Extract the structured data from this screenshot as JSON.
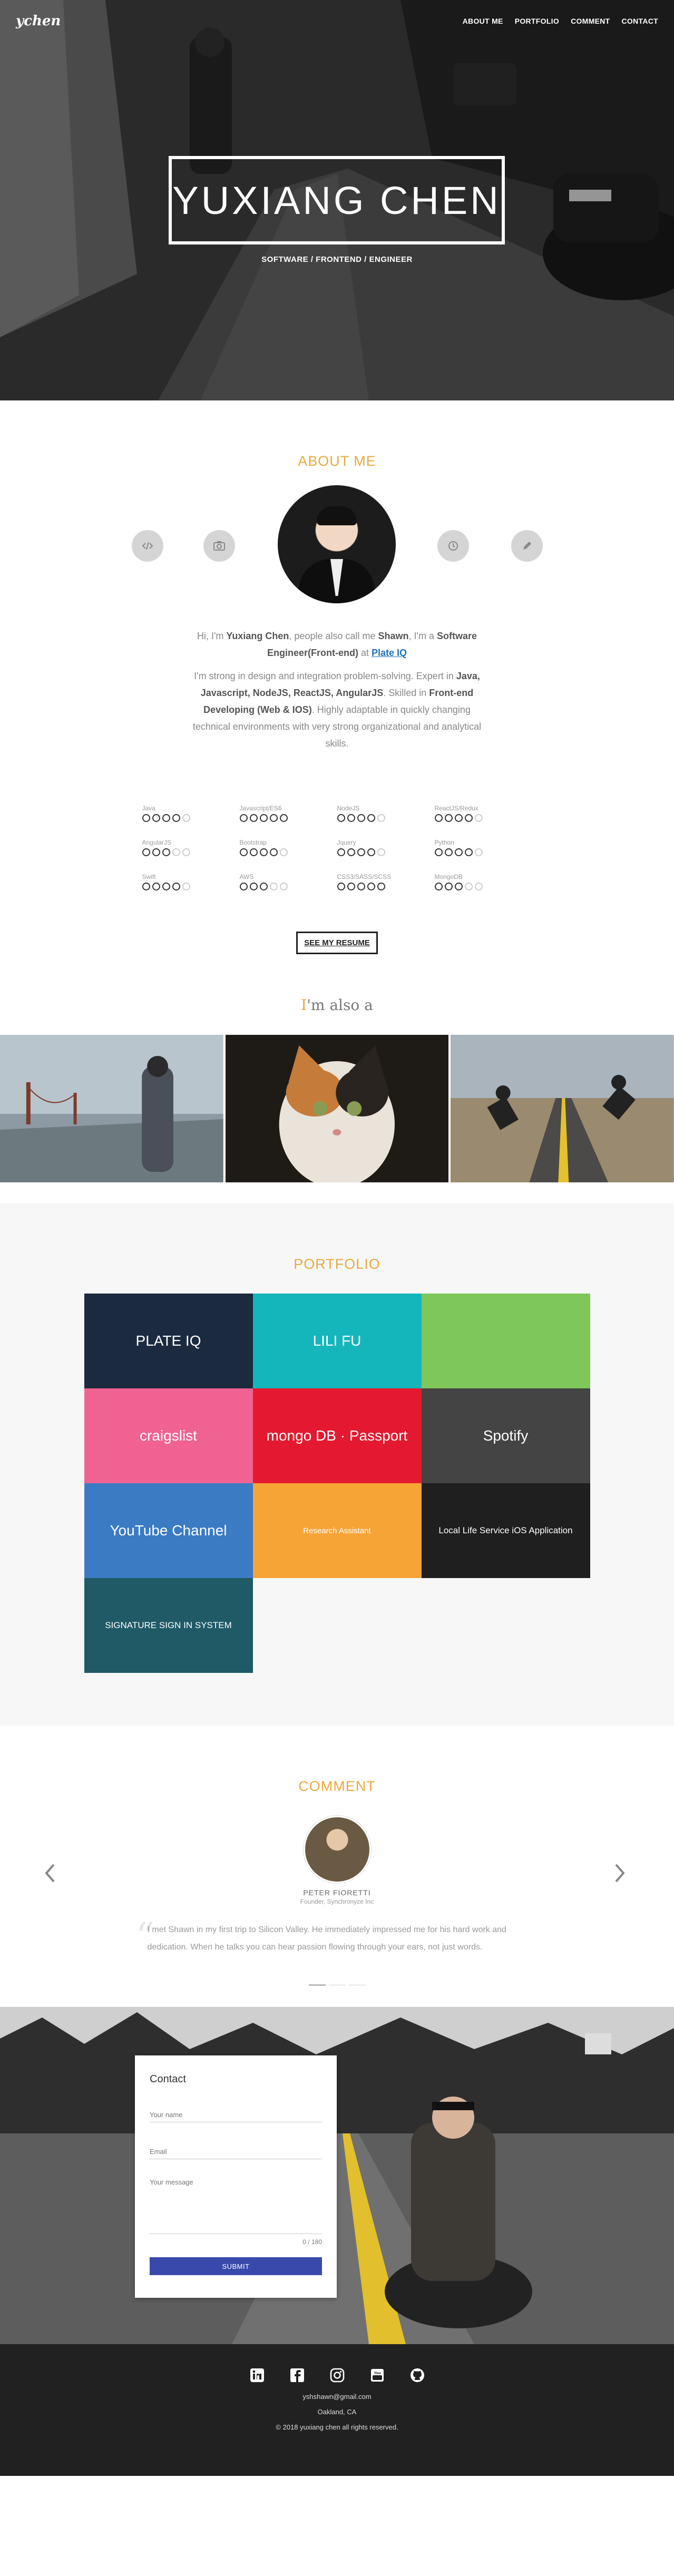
{
  "brand": {
    "logo": "ychen"
  },
  "nav": [
    {
      "label": "ABOUT ME"
    },
    {
      "label": "PORTFOLIO"
    },
    {
      "label": "COMMENT"
    },
    {
      "label": "CONTACT"
    }
  ],
  "hero": {
    "name": "YUXIANG CHEN",
    "subtitle": "SOFTWARE / FRONTEND / ENGINEER"
  },
  "about": {
    "title": "ABOUT ME",
    "icons": [
      "code-icon",
      "camera-icon",
      "clock-icon",
      "pencil-icon"
    ],
    "p1_a": "Hi, I'm ",
    "p1_name": "Yuxiang Chen",
    "p1_b": ", people also call me ",
    "p1_nick": "Shawn",
    "p1_c": ", I'm a ",
    "p1_role": "Software Engineer(Front-end)",
    "p1_d": " at ",
    "p1_company": "Plate IQ",
    "p2_a": "I'm strong in design and integration problem-solving. Expert in ",
    "p2_tech": "Java, Javascript, NodeJS, ReactJS, AngularJS",
    "p2_b": ". Skilled in ",
    "p2_dev": "Front-end Developing (Web & IOS)",
    "p2_c": ". Highly adaptable in quickly changing technical environments with very strong organizational and analytical skills.",
    "resume_label": "SEE MY RESUME",
    "also_i": "I",
    "also_rest": "'m also a"
  },
  "skills": [
    {
      "name": "Java",
      "level": 4
    },
    {
      "name": "Javascript/ES6",
      "level": 5
    },
    {
      "name": "NodeJS",
      "level": 4
    },
    {
      "name": "ReactJS/Redux",
      "level": 4
    },
    {
      "name": "AngularJS",
      "level": 3
    },
    {
      "name": "Bootstrap",
      "level": 4
    },
    {
      "name": "Jquery",
      "level": 4
    },
    {
      "name": "Python",
      "level": 4
    },
    {
      "name": "Swift",
      "level": 4
    },
    {
      "name": "AWS",
      "level": 3
    },
    {
      "name": "CSS3/SASS/SCSS",
      "level": 5
    },
    {
      "name": "MongoDB",
      "level": 3
    }
  ],
  "portfolio": {
    "title": "PORTFOLIO",
    "tiles": [
      {
        "label": "PLATE IQ",
        "bg": "#1b2a3f"
      },
      {
        "label": "LILI FU",
        "bg": "#14b6bb"
      },
      {
        "label": "",
        "bg": "#7dc75b"
      },
      {
        "label": "craigslist",
        "bg": "#f06292"
      },
      {
        "label": "mongo DB · Passport",
        "bg": "#e4192f"
      },
      {
        "label": "Spotify",
        "bg": "#444444"
      },
      {
        "label": "YouTube Channel",
        "bg": "#3a7bc4"
      },
      {
        "label": "Research Assistant",
        "bg": "#f7a437"
      },
      {
        "label": "Local Life Service iOS Application",
        "bg": "#1f1f1f"
      },
      {
        "label": "SIGNATURE SIGN IN SYSTEM",
        "bg": "#1f5a66"
      }
    ]
  },
  "comment": {
    "title": "COMMENT",
    "name": "PETER FIORETTI",
    "role": "Founder, Synchronyze Inc",
    "quote": "I met Shawn in my first trip to Silicon Valley. He immediately impressed me for his hard work and dedication. When he talks you can hear passion flowing through your ears, not just words."
  },
  "contact": {
    "title": "Contact",
    "name_placeholder": "Your name",
    "email_placeholder": "Email",
    "message_placeholder": "Your message",
    "counter": "0 / 180",
    "submit_label": "SUBMIT"
  },
  "footer": {
    "socials": [
      "linkedin-icon",
      "facebook-icon",
      "instagram-icon",
      "youtube-icon",
      "github-icon"
    ],
    "email": "yshshawn@gmail.com",
    "location": "Oakland, CA",
    "copyright": "© 2018 yuxiang chen all rights reserved."
  }
}
